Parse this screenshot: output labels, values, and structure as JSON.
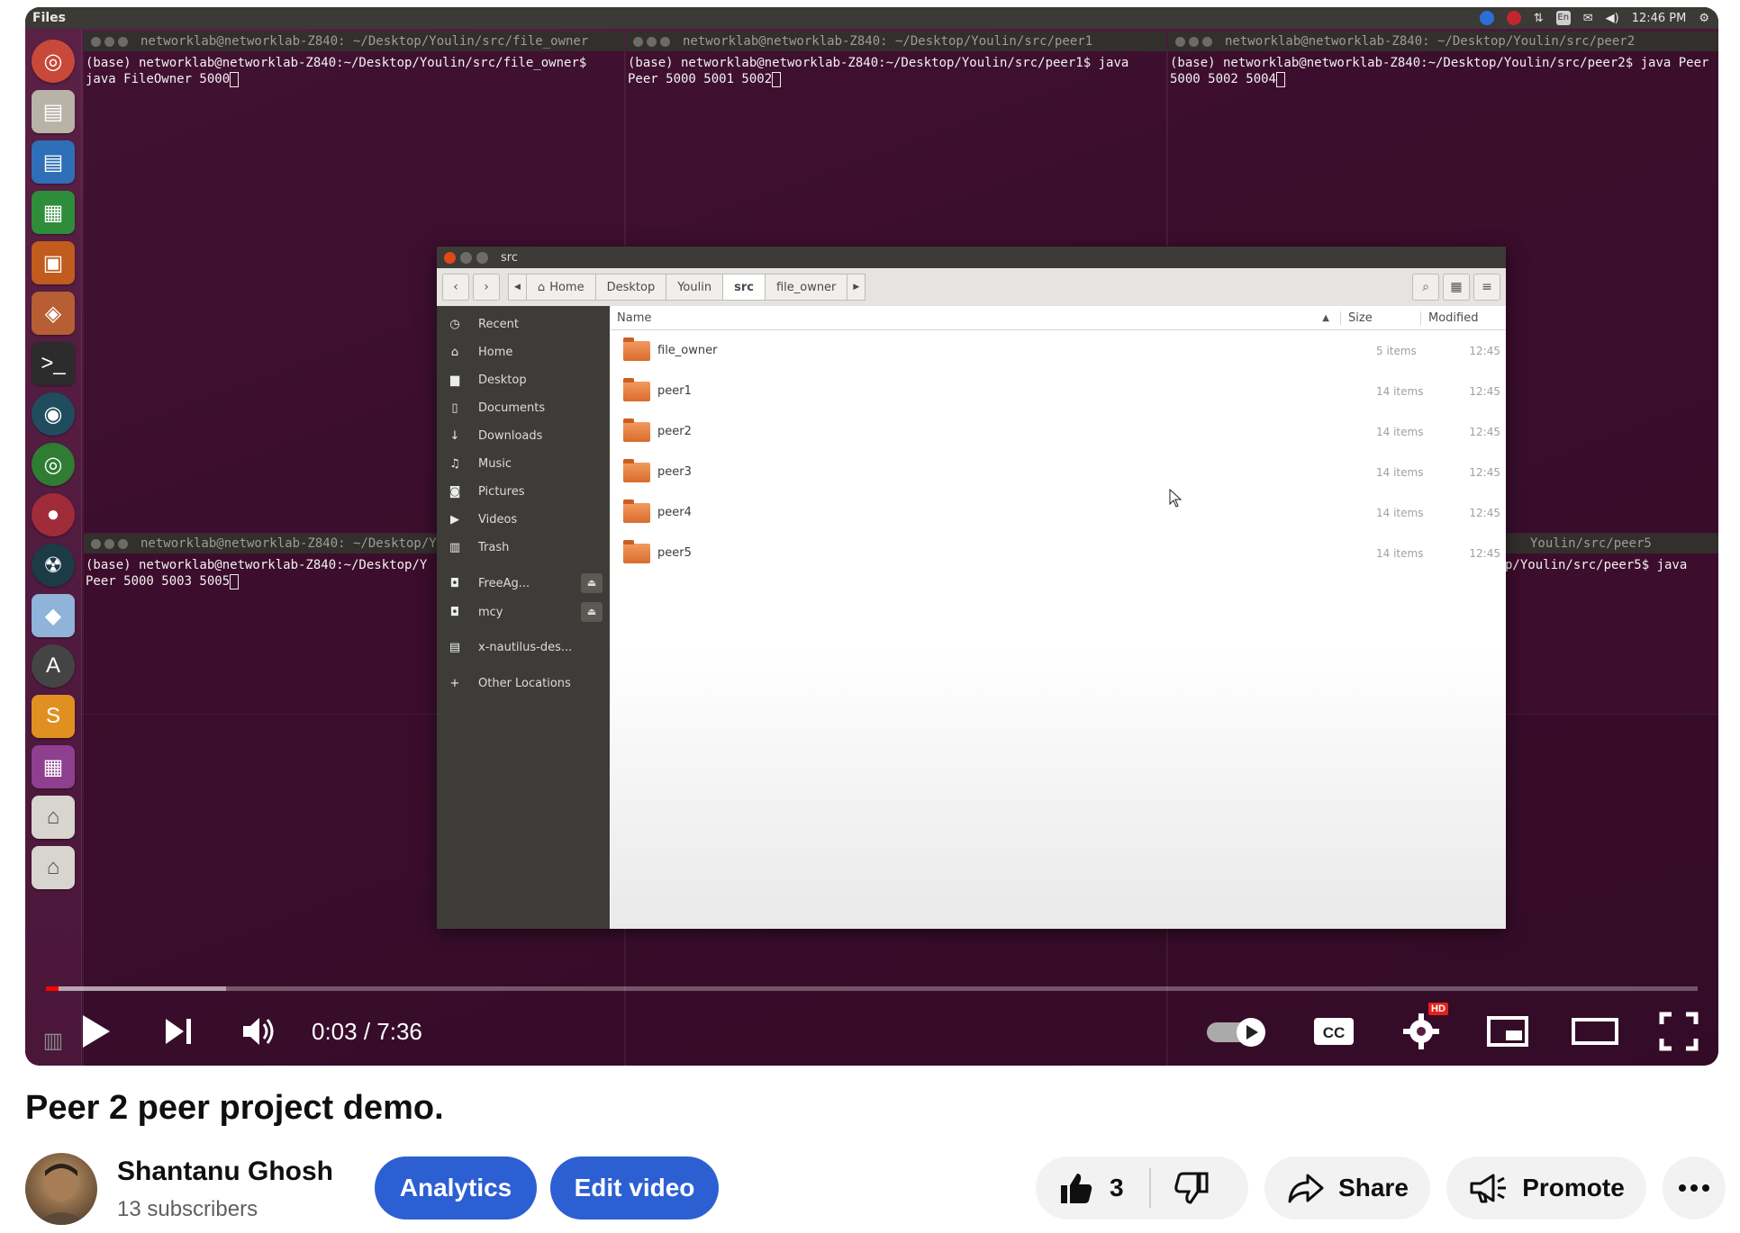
{
  "topbar": {
    "app_name": "Files",
    "clock": "12:46 PM",
    "keyboard": "En"
  },
  "terminals": [
    {
      "title": "networklab@networklab-Z840: ~/Desktop/Youlin/src/file_owner",
      "lines": "(base) networklab@networklab-Z840:~/Desktop/Youlin/src/file_owner$ java FileOwner 5000"
    },
    {
      "title": "networklab@networklab-Z840: ~/Desktop/Youlin/src/peer1",
      "lines": "(base) networklab@networklab-Z840:~/Desktop/Youlin/src/peer1$ java Peer 5000 5001 5002"
    },
    {
      "title": "networklab@networklab-Z840: ~/Desktop/Youlin/src/peer2",
      "lines": "(base) networklab@networklab-Z840:~/Desktop/Youlin/src/peer2$ java Peer 5000 5002 5004"
    },
    {
      "title": "networklab@networklab-Z840: ~/Desktop/Yo",
      "lines": "(base) networklab@networklab-Z840:~/Desktop/Y Peer 5000 5003 5005"
    },
    {
      "title": "Youlin/src/peer5",
      "lines": "p/Youlin/src/peer5$ java"
    }
  ],
  "file_manager": {
    "title": "src",
    "breadcrumbs": [
      "Home",
      "Desktop",
      "Youlin",
      "src",
      "file_owner"
    ],
    "sidebar": [
      {
        "icon": "clock-icon",
        "glyph": "◷",
        "label": "Recent"
      },
      {
        "icon": "home-icon",
        "glyph": "⌂",
        "label": "Home"
      },
      {
        "icon": "folder-icon",
        "glyph": "▆",
        "label": "Desktop"
      },
      {
        "icon": "document-icon",
        "glyph": "▯",
        "label": "Documents"
      },
      {
        "icon": "download-icon",
        "glyph": "↓",
        "label": "Downloads"
      },
      {
        "icon": "music-icon",
        "glyph": "♫",
        "label": "Music"
      },
      {
        "icon": "camera-icon",
        "glyph": "◙",
        "label": "Pictures"
      },
      {
        "icon": "video-icon",
        "glyph": "▶",
        "label": "Videos"
      },
      {
        "icon": "trash-icon",
        "glyph": "▥",
        "label": "Trash"
      },
      {
        "icon": "drive-icon",
        "glyph": "◘",
        "label": "FreeAg..."
      },
      {
        "icon": "drive-icon",
        "glyph": "◘",
        "label": "mcy"
      },
      {
        "icon": "network-icon",
        "glyph": "▤",
        "label": "x-nautilus-des..."
      },
      {
        "icon": "plus-icon",
        "glyph": "+",
        "label": "Other Locations"
      }
    ],
    "columns": {
      "name": "Name",
      "size": "Size",
      "modified": "Modified"
    },
    "rows": [
      {
        "name": "file_owner",
        "size": "5 items",
        "modified": "12:45"
      },
      {
        "name": "peer1",
        "size": "14 items",
        "modified": "12:45"
      },
      {
        "name": "peer2",
        "size": "14 items",
        "modified": "12:45"
      },
      {
        "name": "peer3",
        "size": "14 items",
        "modified": "12:45"
      },
      {
        "name": "peer4",
        "size": "14 items",
        "modified": "12:45"
      },
      {
        "name": "peer5",
        "size": "14 items",
        "modified": "12:45"
      }
    ]
  },
  "player": {
    "time": "0:03 / 7:36",
    "progress_fraction": 0.0066,
    "hd_badge": "HD",
    "cc_label": "CC"
  },
  "video": {
    "title": "Peer 2 peer project demo.",
    "channel": "Shantanu Ghosh",
    "subscribers": "13 subscribers",
    "analytics_label": "Analytics",
    "edit_label": "Edit video",
    "like_count": "3",
    "share_label": "Share",
    "promote_label": "Promote"
  }
}
